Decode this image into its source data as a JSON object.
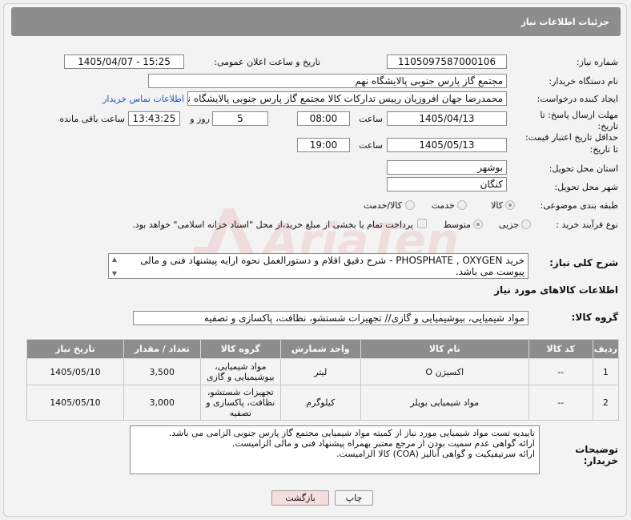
{
  "header": {
    "title": "جزئیات اطلاعات نیاز"
  },
  "fields": {
    "need_number_label": "شماره نیاز:",
    "need_number": "1105097587000106",
    "announce_label": "تاریخ و ساعت اعلان عمومی:",
    "announce_value": "1405/04/07 - 15:25",
    "buyer_org_label": "نام دستگاه خریدار:",
    "buyer_org": "مجتمع گاز پارس جنوبی  پالایشگاه نهم",
    "creator_label": "ایجاد کننده درخواست:",
    "creator": "محمدرضا جهان افروزیان رییس تدارکات کالا مجتمع گاز پارس جنوبی  پالایشگاه نهم",
    "contact_link": "اطلاعات تماس خریدار",
    "deadline_label_1": "مهلت ارسال پاسخ: تا",
    "deadline_label_2": "تاریخ:",
    "deadline_date": "1405/04/13",
    "time_label": "ساعت",
    "deadline_time": "08:00",
    "days_value": "5",
    "days_label": "روز و",
    "remaining_time": "13:43:25",
    "remaining_label": "ساعت باقی مانده",
    "validity_label_1": "حداقل تاریخ اعتبار قیمت:",
    "validity_label_2": "تا تاریخ:",
    "validity_date": "1405/05/13",
    "validity_time": "19:00",
    "province_label": "استان محل تحویل:",
    "province": "بوشهر",
    "city_label": "شهر محل تحویل:",
    "city": "کنگان",
    "category_label": "طبقه بندی موضوعی:",
    "category_options": [
      "کالا",
      "خدمت",
      "کالا/خدمت"
    ],
    "category_selected": "کالا",
    "process_label": "نوع فرآیند خرید :",
    "process_options": [
      "جزیی",
      "متوسط"
    ],
    "process_selected": "متوسط",
    "payment_note": "پرداخت تمام یا بخشی از مبلغ خرید،از محل \"اسناد خزانه اسلامی\" خواهد بود."
  },
  "description": {
    "label": "شرح کلی نیاز:",
    "text": "خرید PHOSPHATE , OXYGEN - شرح دقیق اقلام و دستورالعمل نحوه ارایه پیشنهاد فنی و مالی پیوست می باشد."
  },
  "goods_info": {
    "title": "اطلاعات کالاهای مورد نیاز",
    "group_label": "گروه کالا:",
    "group_value": "مواد شیمیایی، بیوشیمیایی و  گازی// تجهیزات شستشو، نظافت، پاکسازی و تصفیه"
  },
  "table": {
    "headers": [
      "ردیف",
      "کد کالا",
      "نام کالا",
      "واحد شمارش",
      "گروه کالا",
      "تعداد / مقدار",
      "تاریخ نیاز"
    ],
    "rows": [
      [
        "1",
        "--",
        "اکسیژن O",
        "لیتر",
        "مواد شیمیایی، بیوشیمیایی و گازی",
        "3,500",
        "1405/05/10"
      ],
      [
        "2",
        "--",
        "مواد شیمیایی بویلر",
        "کیلوگرم",
        "تجهیزات شستشو، نظافت، پاکسازی و تصفیه",
        "3,000",
        "1405/05/10"
      ]
    ]
  },
  "buyer_notes": {
    "label": "توضیحات خریدار:",
    "lines": [
      "تاییدیه تست مواد شیمیایی مورد نیاز از کمیته مواد شیمیایی مجتمع گاز پارس جنوبی الزامی می باشد.",
      "ارائه گواهی عدم سمیت بودن از مرجع معتبر بهمراه پیشنهاد فنی و مالی الزامیست.",
      "ارائه سرتیفیکیت و گواهی آنالیز (COA) کالا الزامیست."
    ]
  },
  "buttons": {
    "print": "چاپ",
    "back": "بازگشت"
  },
  "watermark": {
    "text": "AriaTender.neT"
  },
  "colors": {
    "header_bg": "#8d8d8d",
    "link": "#1a56b8",
    "back_button_bg": "#f7dede",
    "watermark": "#e06a6a"
  }
}
